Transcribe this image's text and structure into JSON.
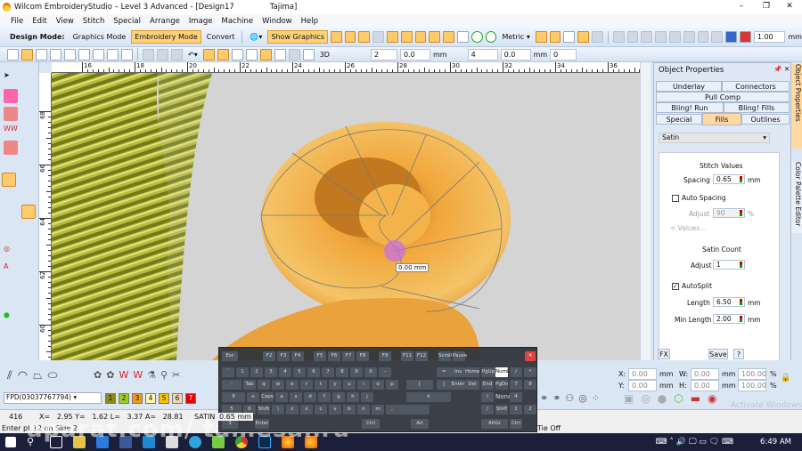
{
  "window": {
    "title": "Wilcom EmbroideryStudio – Level 3 Advanced - [Design17",
    "machine": "Tajima]"
  },
  "menu": [
    "File",
    "Edit",
    "View",
    "Stitch",
    "Special",
    "Arrange",
    "Image",
    "Machine",
    "Window",
    "Help"
  ],
  "toolbar1": {
    "design_mode_label": "Design Mode:",
    "graphics_mode": "Graphics Mode",
    "embroidery_mode": "Embroidery Mode",
    "convert": "Convert",
    "show_graphics": "Show Graphics",
    "units": "Metric",
    "zoom_value": "1.00",
    "zoom_unit": "mm"
  },
  "toolbar2": {
    "mm1": "mm",
    "f1": "2",
    "f2": "0.0",
    "mm2": "mm",
    "f3": "4",
    "f4": "0.0",
    "mm3": "mm",
    "f5": "0",
    "label_3d": "3D"
  },
  "rulers": {
    "h": [
      "16",
      "18",
      "20",
      "22",
      "24",
      "26",
      "28",
      "30",
      "32",
      "34",
      "36"
    ],
    "v": [
      "68",
      "66",
      "64",
      "62",
      "60"
    ]
  },
  "canvas": {
    "tooltip": "0.00 mm"
  },
  "panel": {
    "title": "Object Properties",
    "tabs": [
      "Underlay",
      "Connectors",
      "Pull Comp",
      "Bling! Run",
      "Bling! Fills",
      "Special",
      "Fills",
      "Outlines"
    ],
    "stitch_type": "Satin",
    "stitch_values": "Stitch Values",
    "spacing_label": "Spacing",
    "spacing": "0.65",
    "mm": "mm",
    "auto_spacing": "Auto Spacing",
    "adjust_label": "Adjust",
    "adjust_pct": "90",
    "pct": "%",
    "values_btn": "Values...",
    "satin_count": "Satin Count",
    "adjust2_label": "Adjust",
    "adjust2": "1",
    "autosplit": "AutoSplit",
    "length_label": "Length",
    "length": "6.50",
    "min_length_label": "Min Length",
    "min_length": "2.00",
    "fx": "FX",
    "save": "Save",
    "help": "?"
  },
  "sidetabs": [
    "Object Properties",
    "Color Palette Editor"
  ],
  "transform": {
    "x_label": "X:",
    "x": "0.00",
    "y_label": "Y:",
    "y": "0.00",
    "w_label": "W:",
    "w": "0.00",
    "h_label": "H:",
    "h": "0.00",
    "mm": "mm",
    "wp": "100.00",
    "hp": "100.00",
    "pct": "%"
  },
  "bottom": {
    "thread_chart": "FPD(03037767794)",
    "colors": [
      {
        "n": "1",
        "c": "#8a8a1a"
      },
      {
        "n": "2",
        "c": "#9ccc2a"
      },
      {
        "n": "3",
        "c": "#f29a1a"
      },
      {
        "n": "4",
        "c": "#fff4b0"
      },
      {
        "n": "5",
        "c": "#f5c400"
      },
      {
        "n": "6",
        "c": "#f7d3b5"
      },
      {
        "n": "7",
        "c": "#e60000"
      }
    ]
  },
  "status": {
    "count": "416",
    "coords": "X=   2.95 Y=   1.62 L=   3.37 A=   28.81",
    "stitch": "SATIN",
    "spacing": "0.65 mm",
    "prompt": "Enter pt 12 on Side 2",
    "tieoff": "Tie Off",
    "watermark_os": "Activate Windows"
  },
  "taskbar": {
    "time": "6:49 AM"
  },
  "watermark": "aparat.com/ tamesahra",
  "keyboard": {
    "keys": [
      "Esc",
      "F2",
      "F3",
      "F4",
      "F5",
      "F6",
      "F7",
      "F8",
      "F9",
      "F11",
      "F12",
      "Scroll",
      "Pause",
      "`",
      "1",
      "2",
      "3",
      "4",
      "5",
      "6",
      "7",
      "8",
      "9",
      "0",
      "-",
      "=",
      "Ins",
      "Home",
      "PgUp",
      "NumL",
      "/",
      "*",
      "-",
      "Tab",
      "q",
      "w",
      "e",
      "r",
      "t",
      "y",
      "u",
      "i",
      "o",
      "p",
      "[",
      "]",
      "Enter",
      "Del",
      "End",
      "PgDn",
      "7",
      "8",
      "9",
      "+",
      "Caps",
      "a",
      "s",
      "d",
      "f",
      "g",
      "h",
      "j",
      "k",
      "l",
      "None",
      "4",
      "5",
      "6",
      "Shift",
      "\\",
      "z",
      "x",
      "c",
      "v",
      "b",
      "n",
      "m",
      ",",
      ".",
      "/",
      "Shift",
      "1",
      "2",
      "3",
      "Enter",
      "Ctrl",
      "Alt",
      "AltGr",
      "Ctrl",
      "0",
      "."
    ]
  }
}
